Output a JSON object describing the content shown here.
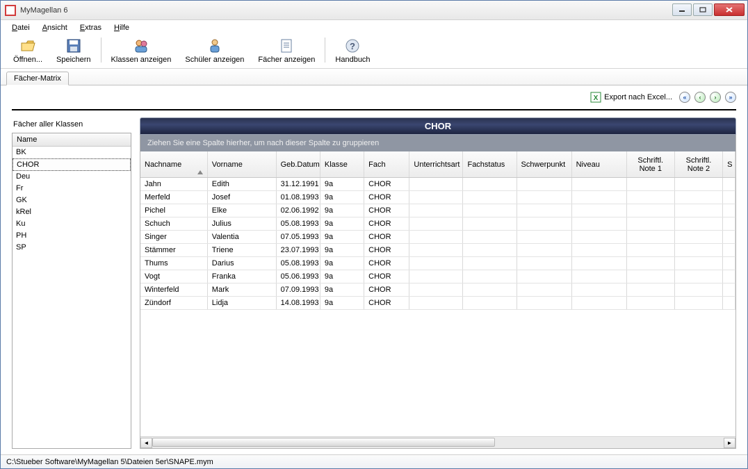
{
  "window": {
    "title": "MyMagellan 6"
  },
  "menu": {
    "datei": "Datei",
    "datei_u": "D",
    "ansicht": "Ansicht",
    "ansicht_u": "A",
    "extras": "Extras",
    "extras_u": "E",
    "hilfe": "Hilfe",
    "hilfe_u": "H"
  },
  "toolbar": {
    "open": "Öffnen...",
    "open_u": "Ö",
    "save": "Speichern",
    "save_u": "S",
    "klassen": "Klassen anzeigen",
    "klassen_u": "K",
    "schueler": "Schüler anzeigen",
    "schueler_u": "S",
    "faecher": "Fächer anzeigen",
    "faecher_u": "F",
    "handbuch": "Handbuch",
    "handbuch_u": "H"
  },
  "tabs": {
    "faecher_matrix": "Fächer-Matrix"
  },
  "actions": {
    "export_excel": "Export nach Excel..."
  },
  "left": {
    "caption": "Fächer aller Klassen",
    "header": "Name",
    "items": [
      "BK",
      "CHOR",
      "Deu",
      "Fr",
      "GK",
      "kRel",
      "Ku",
      "PH",
      "SP"
    ],
    "selected": "CHOR"
  },
  "grid": {
    "title": "CHOR",
    "group_hint": "Ziehen Sie eine Spalte hierher, um nach dieser Spalte zu gruppieren",
    "columns": {
      "nachname": "Nachname",
      "vorname": "Vorname",
      "gebdatum": "Geb.Datum",
      "klasse": "Klasse",
      "fach": "Fach",
      "unterrichtsart": "Unterrichtsart",
      "fachstatus": "Fachstatus",
      "schwerpunkt": "Schwerpunkt",
      "niveau": "Niveau",
      "note1": "Schriftl. Note 1",
      "note2": "Schriftl. Note 2",
      "s": "S"
    },
    "sort_column": "nachname",
    "rows": [
      {
        "nachname": "Jahn",
        "vorname": "Edith",
        "gebdatum": "31.12.1991",
        "klasse": "9a",
        "fach": "CHOR"
      },
      {
        "nachname": "Merfeld",
        "vorname": "Josef",
        "gebdatum": "01.08.1993",
        "klasse": "9a",
        "fach": "CHOR"
      },
      {
        "nachname": "Pichel",
        "vorname": "Elke",
        "gebdatum": "02.06.1992",
        "klasse": "9a",
        "fach": "CHOR"
      },
      {
        "nachname": "Schuch",
        "vorname": "Julius",
        "gebdatum": "05.08.1993",
        "klasse": "9a",
        "fach": "CHOR"
      },
      {
        "nachname": "Singer",
        "vorname": "Valentia",
        "gebdatum": "07.05.1993",
        "klasse": "9a",
        "fach": "CHOR"
      },
      {
        "nachname": "Stämmer",
        "vorname": "Triene",
        "gebdatum": "23.07.1993",
        "klasse": "9a",
        "fach": "CHOR"
      },
      {
        "nachname": "Thums",
        "vorname": "Darius",
        "gebdatum": "05.08.1993",
        "klasse": "9a",
        "fach": "CHOR"
      },
      {
        "nachname": "Vogt",
        "vorname": "Franka",
        "gebdatum": "05.06.1993",
        "klasse": "9a",
        "fach": "CHOR"
      },
      {
        "nachname": "Winterfeld",
        "vorname": "Mark",
        "gebdatum": "07.09.1993",
        "klasse": "9a",
        "fach": "CHOR"
      },
      {
        "nachname": "Zündorf",
        "vorname": "Lidja",
        "gebdatum": "14.08.1993",
        "klasse": "9a",
        "fach": "CHOR"
      }
    ]
  },
  "status": {
    "path": "C:\\Stueber Software\\MyMagellan 5\\Dateien 5er\\SNAPE.mym"
  }
}
